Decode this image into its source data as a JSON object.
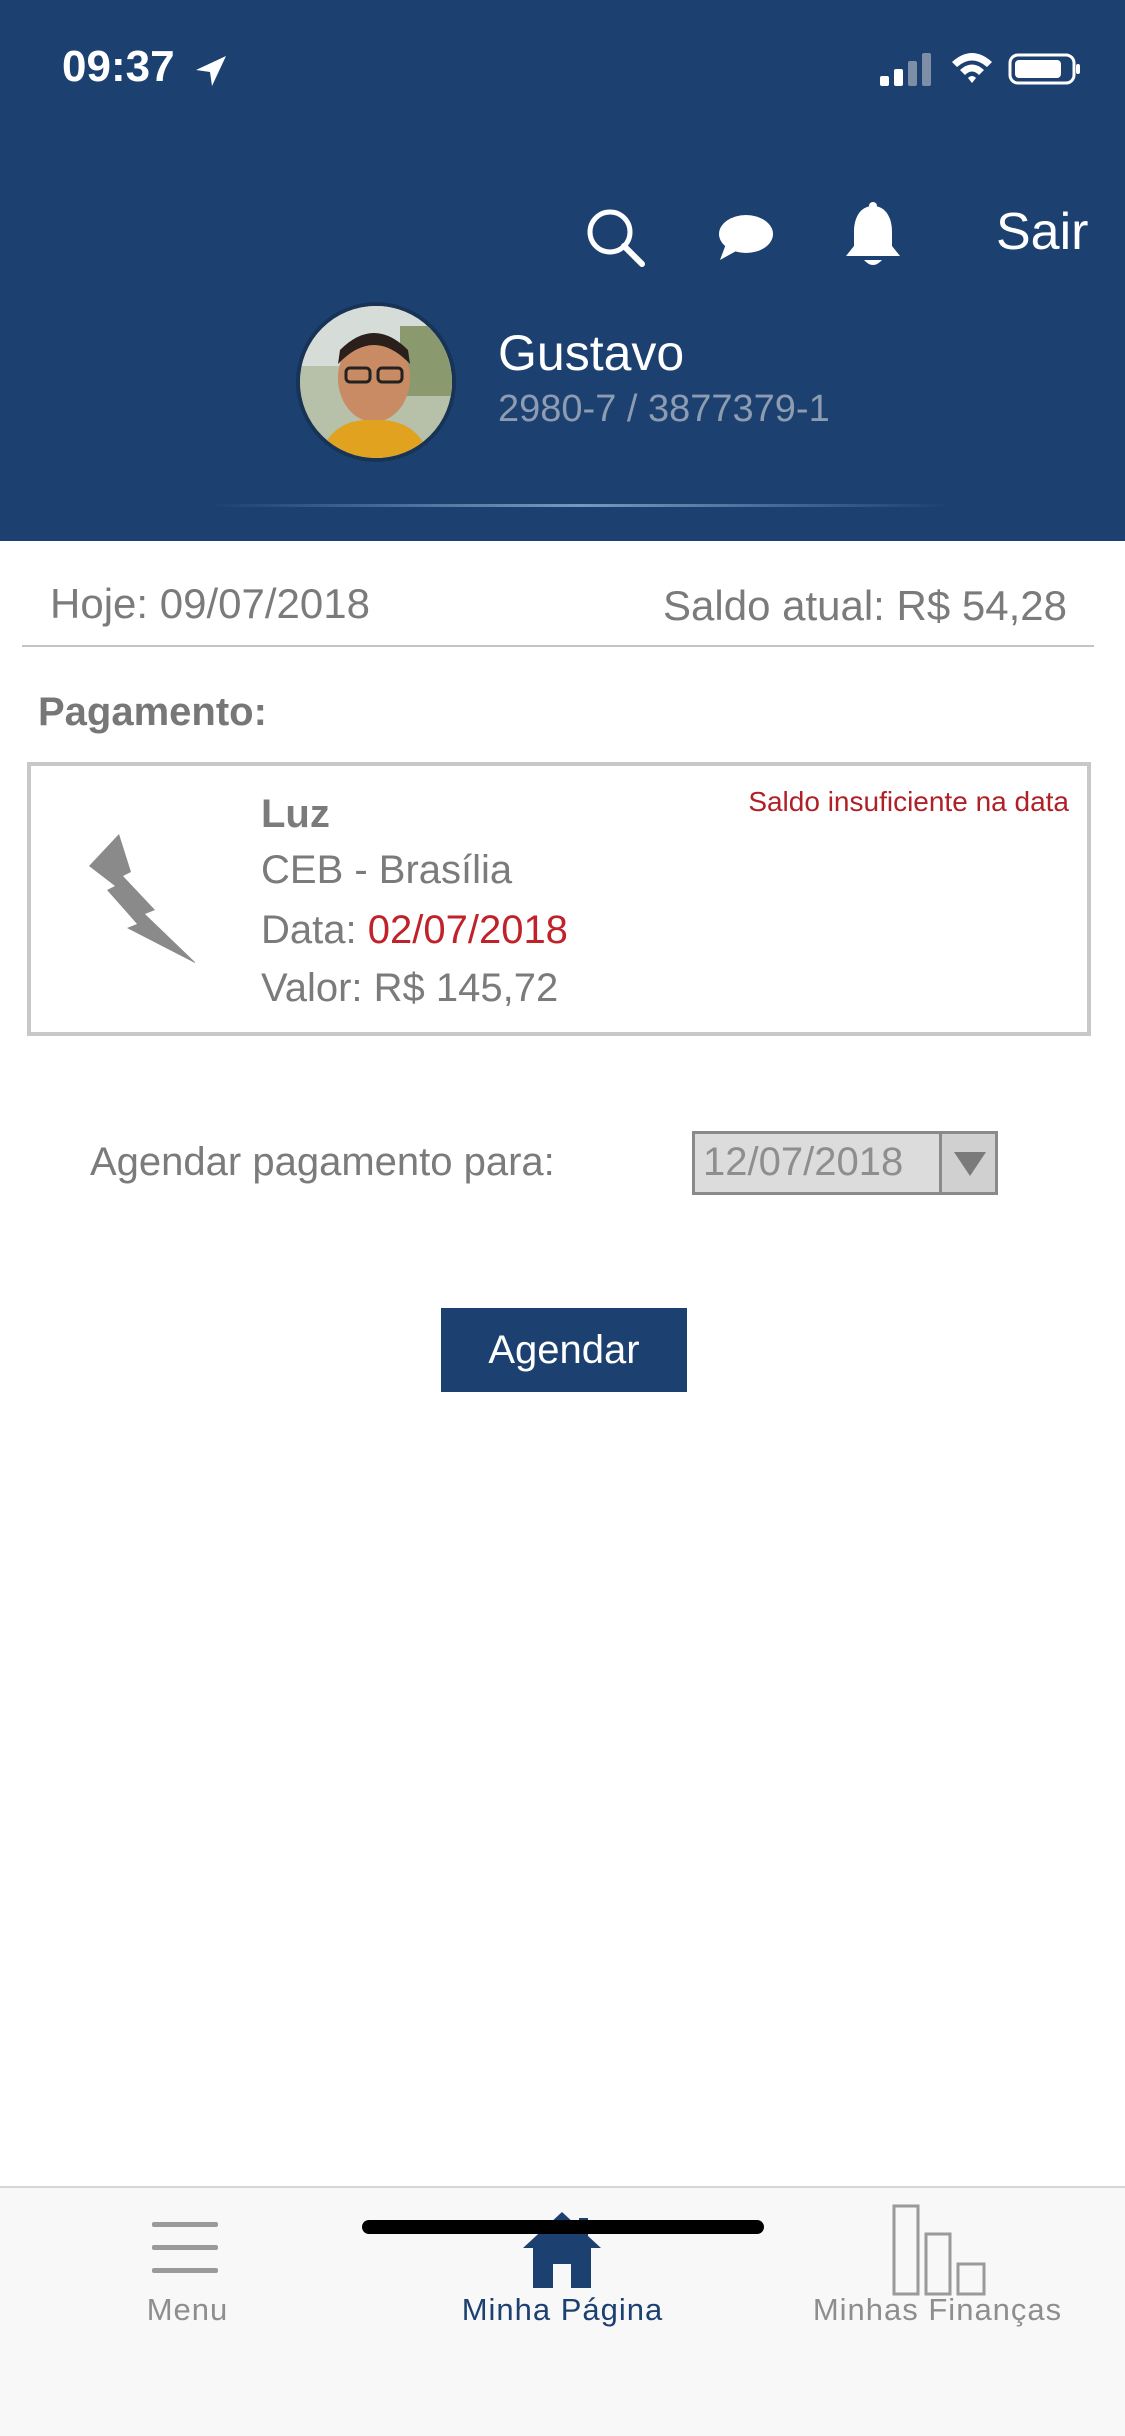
{
  "status_bar": {
    "time": "09:37"
  },
  "header": {
    "logout_label": "Sair",
    "user": {
      "name": "Gustavo",
      "account": "2980-7 / 3877379-1"
    },
    "icons": [
      "search-icon",
      "chat-icon",
      "bell-icon"
    ],
    "background_color": "#1c4170"
  },
  "info": {
    "today_label": "Hoje:",
    "today_value": "09/07/2018",
    "balance_label": "Saldo atual:",
    "balance_value": "R$ 54,28"
  },
  "payment": {
    "section_title": "Pagamento:",
    "icon": "lightning-bolt-icon",
    "name": "Luz",
    "company": "CEB - Brasília",
    "date_label": "Data:",
    "date_value": "02/07/2018",
    "value_label": "Valor:",
    "value_amount": "R$ 145,72",
    "warning": "Saldo insuficiente na data",
    "warning_color": "#b02027"
  },
  "schedule": {
    "label": "Agendar pagamento para:",
    "selected_date": "12/07/2018",
    "button_label": "Agendar"
  },
  "tabbar": {
    "tabs": [
      {
        "label": "Menu",
        "icon": "menu-icon",
        "active": false
      },
      {
        "label": "Minha Página",
        "icon": "home-icon",
        "active": true
      },
      {
        "label": "Minhas Finanças",
        "icon": "bar-chart-icon",
        "active": false
      }
    ],
    "active_color": "#1c4170"
  }
}
